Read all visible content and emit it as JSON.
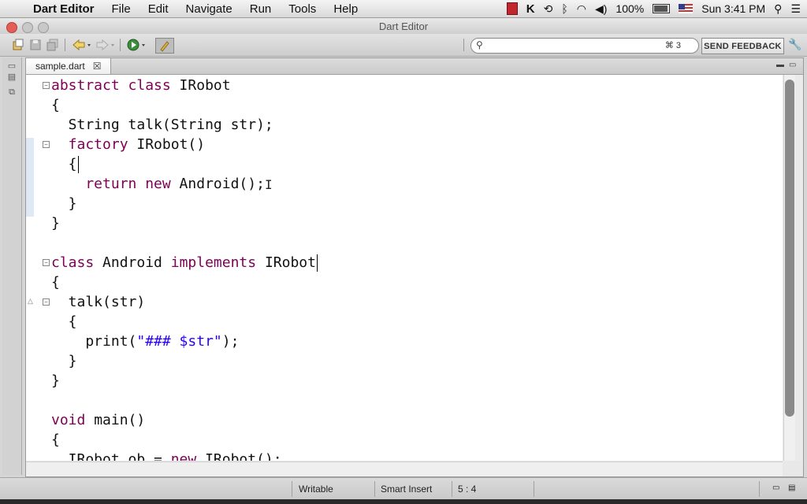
{
  "menubar": {
    "app_name": "Dart Editor",
    "items": [
      "File",
      "Edit",
      "Navigate",
      "Run",
      "Tools",
      "Help"
    ],
    "battery": "100%",
    "clock": "Sun 3:41 PM"
  },
  "window": {
    "title": "Dart Editor"
  },
  "search": {
    "placeholder": "",
    "shortcut": "⌘ 3"
  },
  "toolbar": {
    "send_feedback": "SEND FEEDBACK"
  },
  "editor": {
    "tab_label": "sample.dart",
    "code": {
      "l1_kw": "abstract class",
      "l1_rest": " IRobot",
      "l2": "{",
      "l3": "  String talk(String str);",
      "l4_kw": "  factory",
      "l4_rest": " IRobot()",
      "l5": "  {",
      "l6_kw": "    return new",
      "l6_rest": " Android();",
      "l7": "  }",
      "l8": "}",
      "l10_kw": "class",
      "l10_mid": " Android ",
      "l10_kw2": "implements",
      "l10_rest": " IRobot",
      "l11": "{",
      "l12": "  talk(str)",
      "l13": "  {",
      "l14_a": "    print(",
      "l14_str": "\"### $str\"",
      "l14_b": ");",
      "l15": "  }",
      "l16": "}",
      "l18_kw": "void",
      "l18_rest": " main()",
      "l19": "{",
      "l20_a": "  IRobot ob = ",
      "l20_kw": "new",
      "l20_b": " IRobot();"
    }
  },
  "statusbar": {
    "mode": "Writable",
    "insert": "Smart Insert",
    "position": "5 : 4"
  },
  "colors": {
    "keyword": "#7f0055",
    "string": "#2a00ff",
    "close_button": "#e55e55"
  },
  "icons": [
    "apple-icon",
    "k-icon",
    "time-machine-icon",
    "bluetooth-icon",
    "wifi-icon",
    "volume-icon",
    "battery-icon",
    "flag-icon",
    "spotlight-icon",
    "list-icon",
    "new-file-icon",
    "save-icon",
    "save-all-icon",
    "back-icon",
    "forward-icon",
    "run-icon",
    "clean-icon",
    "search-icon",
    "wrench-icon",
    "close-icon"
  ]
}
